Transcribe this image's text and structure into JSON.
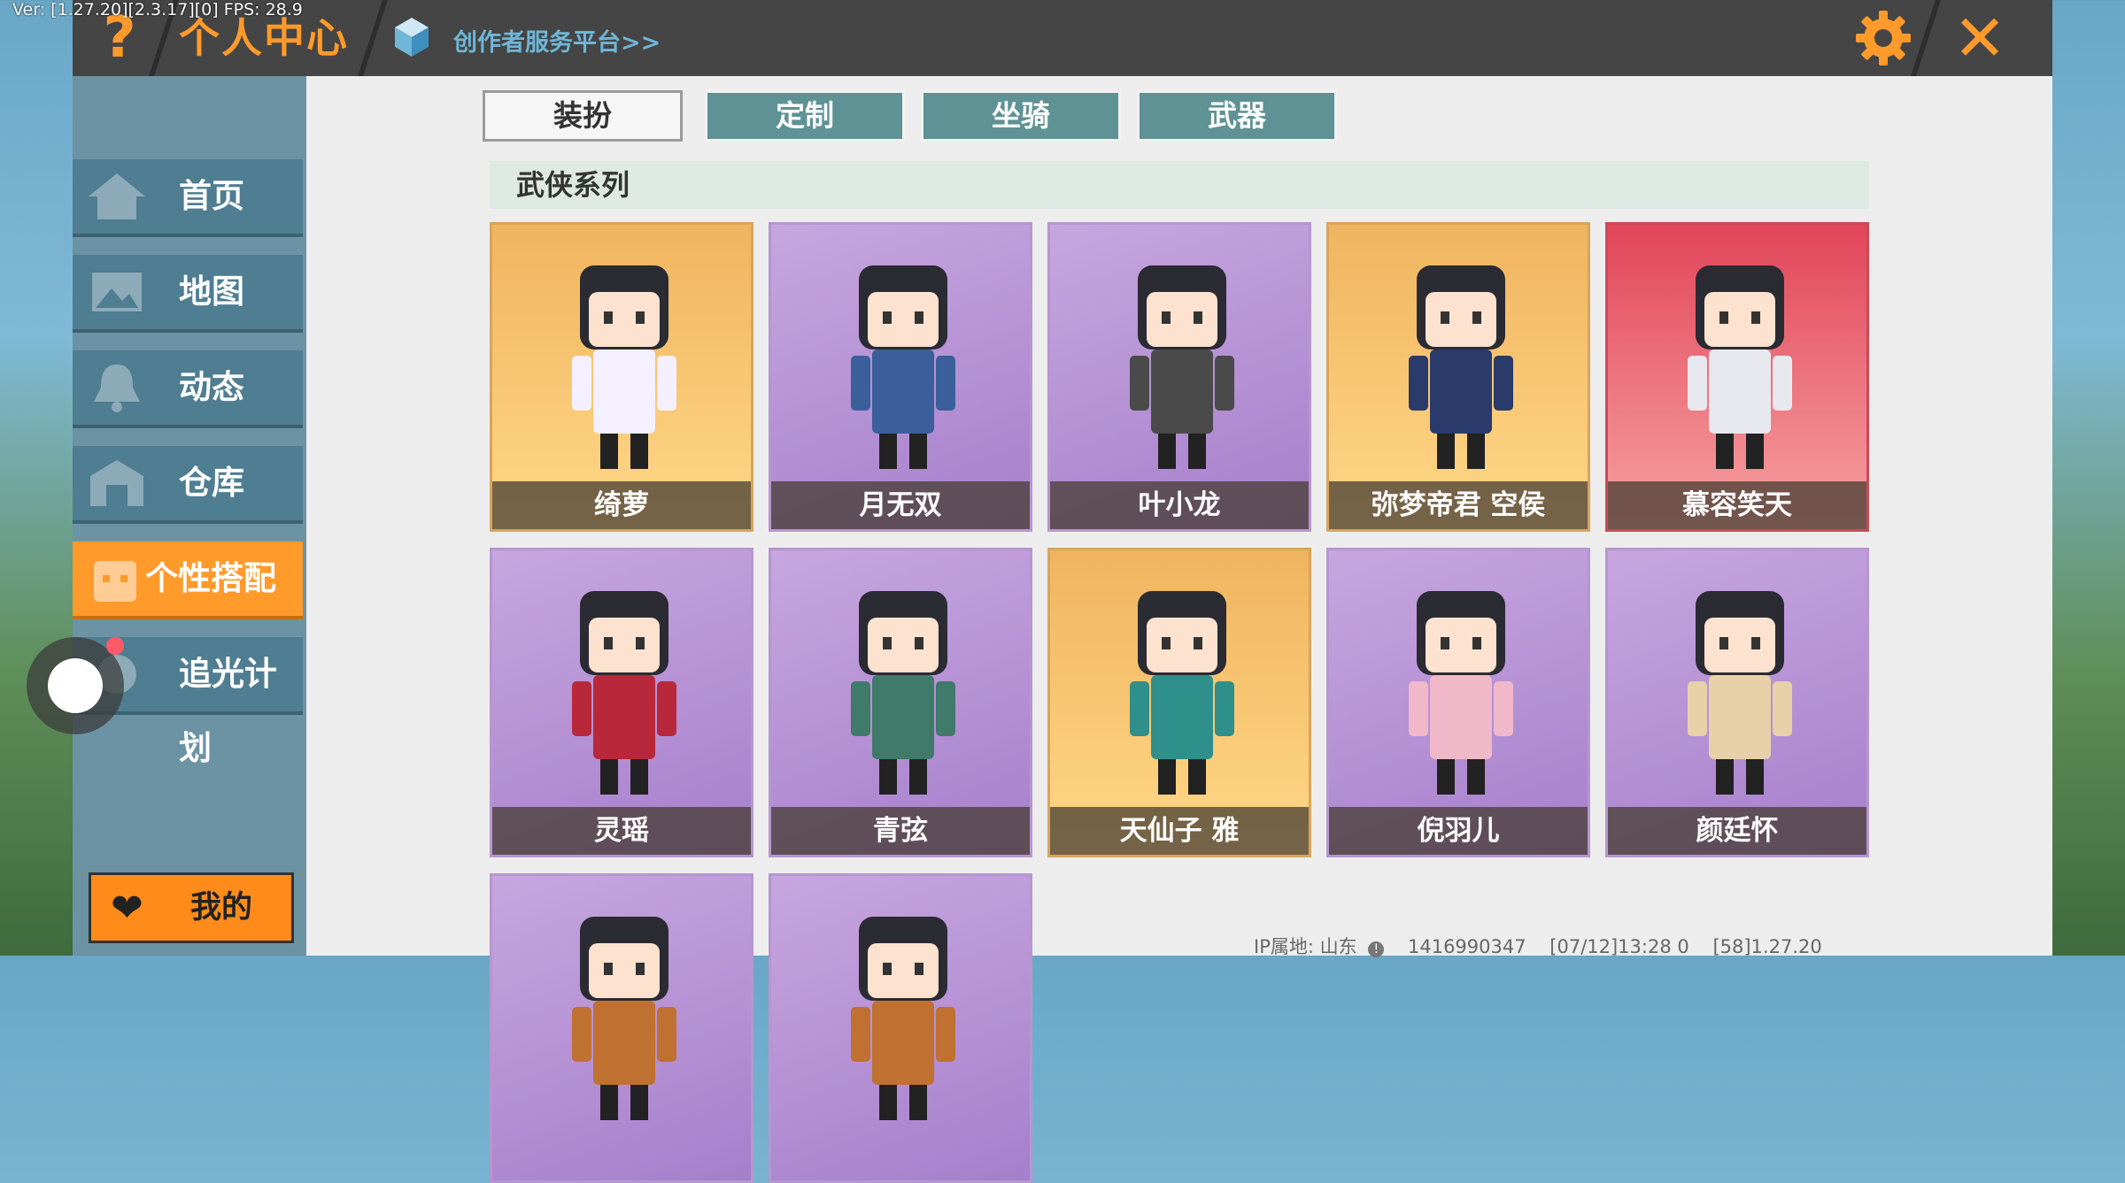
{
  "debug": "Ver: [1.27.20][2.3.17][0] FPS: 28.9",
  "topbar": {
    "help": "?",
    "title": "个人中心",
    "creator_link": "创作者服务平台>>",
    "close": "✕"
  },
  "sidebar": {
    "items": [
      {
        "label": "首页",
        "icon": "home-icon"
      },
      {
        "label": "地图",
        "icon": "map-icon"
      },
      {
        "label": "动态",
        "icon": "bell-icon"
      },
      {
        "label": "仓库",
        "icon": "warehouse-icon"
      },
      {
        "label": "个性搭配",
        "icon": "outfit-icon",
        "active": true
      },
      {
        "label": "追光计划",
        "icon": "plan-icon"
      }
    ],
    "mine": {
      "label": "我的",
      "icon": "heart-icon"
    }
  },
  "tabs": [
    {
      "label": "装扮",
      "active": true
    },
    {
      "label": "定制"
    },
    {
      "label": "坐骑"
    },
    {
      "label": "武器"
    }
  ],
  "section": {
    "title": "武侠系列"
  },
  "cards": [
    {
      "name": "绮萝",
      "style": "gold"
    },
    {
      "name": "月无双",
      "style": "purple"
    },
    {
      "name": "叶小龙",
      "style": "purple"
    },
    {
      "name": "弥梦帝君 空侯",
      "style": "gold"
    },
    {
      "name": "慕容笑天",
      "style": "red"
    },
    {
      "name": "灵瑶",
      "style": "purple"
    },
    {
      "name": "青弦",
      "style": "purple"
    },
    {
      "name": "天仙子 雅",
      "style": "gold"
    },
    {
      "name": "倪羽儿",
      "style": "purple"
    },
    {
      "name": "颜廷怀",
      "style": "purple"
    },
    {
      "name": "",
      "style": "purple"
    },
    {
      "name": "",
      "style": "purple"
    }
  ],
  "footer": {
    "ip": "IP属地: 山东",
    "uid": "1416990347",
    "time": "[07/12]13:28 0",
    "ver": "[58]1.27.20"
  },
  "colors": {
    "accent": "#ff9a2b",
    "tab": "#5e9294",
    "sidebar": "#4f7d91"
  }
}
